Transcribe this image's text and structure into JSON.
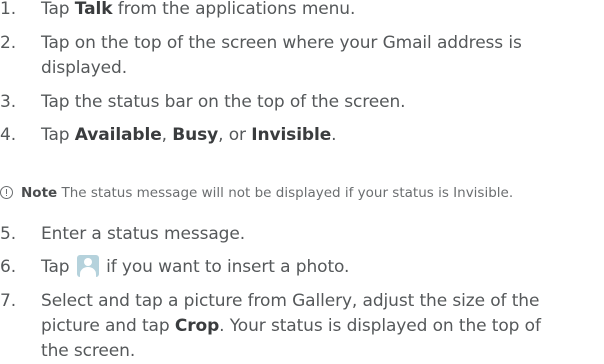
{
  "steps": [
    {
      "num": "1.",
      "before": "Tap ",
      "bold": "Talk",
      "after": " from the applications menu."
    },
    {
      "num": "2.",
      "line1": "Tap on the top of the screen where your Gmail address is",
      "line2": "displayed."
    },
    {
      "num": "3.",
      "text": "Tap the status bar on the top of the screen."
    },
    {
      "num": "4.",
      "before": "Tap ",
      "bold1": "Available",
      "sep1": ", ",
      "bold2": "Busy",
      "sep2": ", or ",
      "bold3": "Invisible",
      "after": "."
    },
    {
      "num": "5.",
      "text": "Enter a status message."
    },
    {
      "num": "6.",
      "before": "Tap ",
      "icon": "person-photo-icon",
      "after": " if you want to insert a photo."
    },
    {
      "num": "7.",
      "line1": "Select and tap a picture from Gallery, adjust the size of the",
      "line2_before": "picture and tap ",
      "line2_bold": "Crop",
      "line2_after": ". Your status is displayed on the top of",
      "line3": "the screen."
    }
  ],
  "note": {
    "icon": "info-circle-icon",
    "label": "Note",
    "text": " The status message will not be displayed if your status is Invisible."
  },
  "colors": {
    "text": "#55585a",
    "bold": "#3a3c3e",
    "note": "#6b6e70",
    "photo_icon": "#b5d2dc"
  }
}
